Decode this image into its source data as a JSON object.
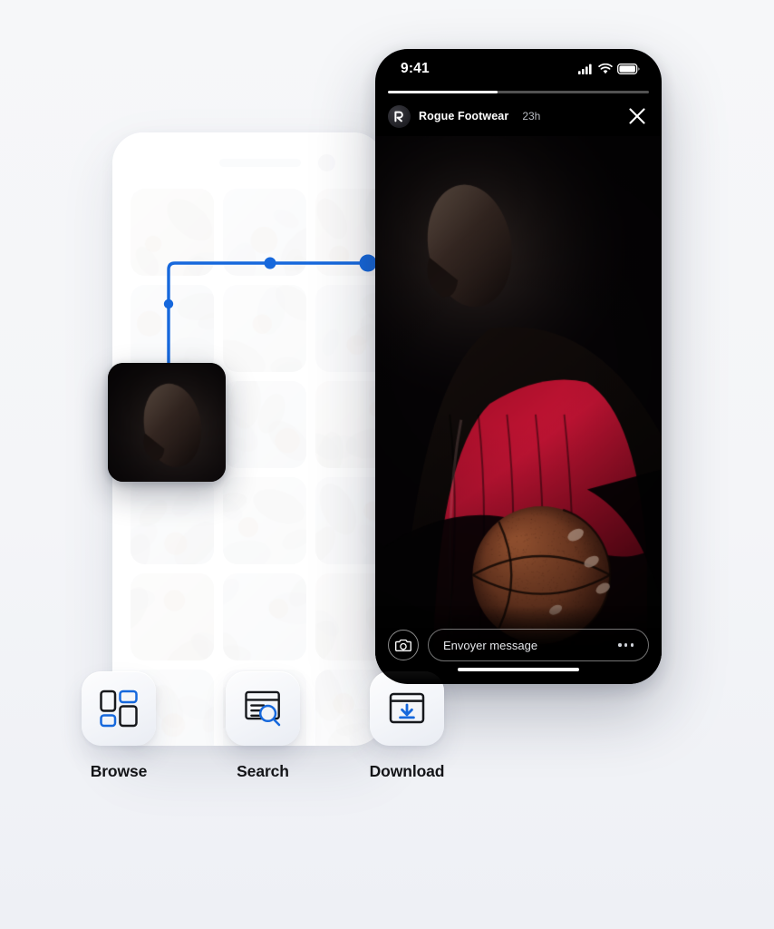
{
  "background_color": "#f4f6f9",
  "accent_color": "#1668dc",
  "story_phone": {
    "status_bar": {
      "time": "9:41",
      "cellular_icon": "signal-bars-icon",
      "wifi_icon": "wifi-icon",
      "battery_icon": "battery-icon"
    },
    "story_progress_percent": 42,
    "header": {
      "avatar_icon": "rogue-footwear-logo-icon",
      "account_name": "Rogue Footwear",
      "timestamp": "23h",
      "close_icon": "close-icon"
    },
    "photo_alt": "basketball-player-holding-ball",
    "footer": {
      "camera_icon": "camera-icon",
      "message_placeholder": "Envoyer message",
      "more_icon": "more-options-icon"
    },
    "home_indicator": "home-indicator"
  },
  "browse_phone": {
    "search_placeholder": "",
    "avatar_icon": "profile-avatar-icon",
    "grid_label": "basketball-photo-grid"
  },
  "drag_thumb": {
    "alt": "dragged-photo-thumbnail"
  },
  "connector": {
    "node_count": 3,
    "color": "#1668dc"
  },
  "features": [
    {
      "id": "browse",
      "label": "Browse",
      "icon": "browse-grid-icon"
    },
    {
      "id": "search",
      "label": "Search",
      "icon": "document-search-icon"
    },
    {
      "id": "download",
      "label": "Download",
      "icon": "download-window-icon"
    }
  ]
}
